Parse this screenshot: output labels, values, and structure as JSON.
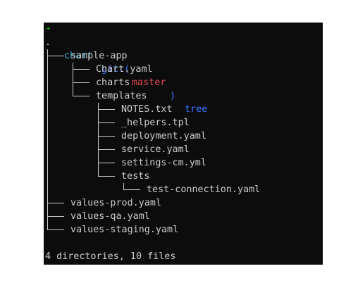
{
  "prompt": {
    "arrow": "➜",
    "directory": "chart",
    "git_label": "git:(",
    "branch": "master",
    "git_close": ")",
    "command": "tree"
  },
  "tree": {
    "root": ".",
    "entries": [
      {
        "name": "sample-app"
      },
      {
        "name": "Chart.yaml"
      },
      {
        "name": "charts"
      },
      {
        "name": "templates"
      },
      {
        "name": "NOTES.txt"
      },
      {
        "name": "_helpers.tpl"
      },
      {
        "name": "deployment.yaml"
      },
      {
        "name": "service.yaml"
      },
      {
        "name": "settings-cm.yml"
      },
      {
        "name": "tests"
      },
      {
        "name": "test-connection.yaml"
      },
      {
        "name": "values-prod.yaml"
      },
      {
        "name": "values-qa.yaml"
      },
      {
        "name": "values-staging.yaml"
      }
    ]
  },
  "summary": "4 directories, 10 files",
  "colors": {
    "background": "#0c0c0c",
    "text": "#cccccc",
    "prompt_arrow": "#16c60c",
    "directory": "#3ab0d8",
    "git": "#3b78ff",
    "branch": "#e74856"
  }
}
